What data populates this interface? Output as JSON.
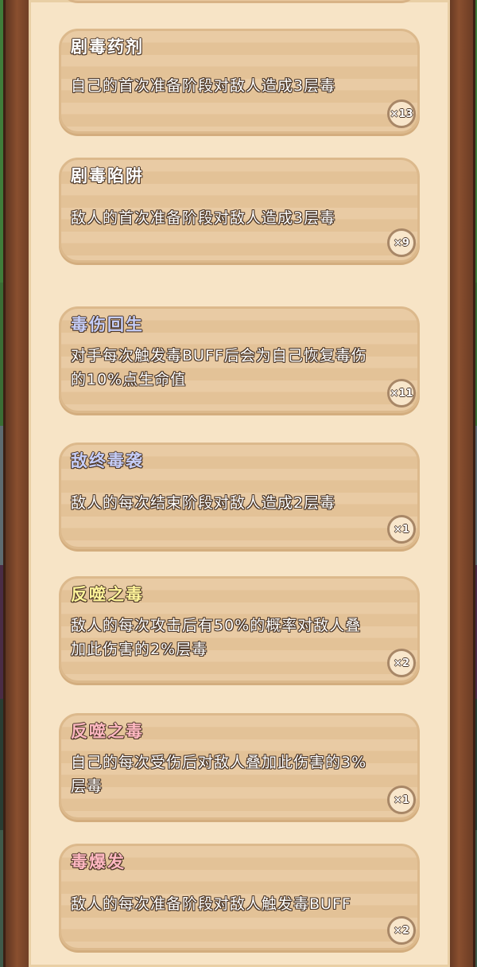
{
  "colors": {
    "title_default": "#ffffff",
    "title_blue": "#c5cdf8",
    "title_yellow": "#fff59a",
    "title_pink": "#ffb8c2",
    "outline": "#4a3526",
    "card": "#e8c89e",
    "panel": "#f7e4c6"
  },
  "cards": [
    {
      "title": "剧毒药剂",
      "description": "自己的首次准备阶段对敌人造成3层毒",
      "count": "×13",
      "title_color": "#ffffff"
    },
    {
      "title": "剧毒陷阱",
      "description": "敌人的首次准备阶段对敌人造成3层毒",
      "count": "×9",
      "title_color": "#ffffff"
    },
    {
      "title": "毒伤回生",
      "description": "对手每次触发毒BUFF后会为自己恢复毒伤的10%点生命值",
      "count": "×11",
      "title_color": "#c5cdf8"
    },
    {
      "title": "敌终毒袭",
      "description": "敌人的每次结束阶段对敌人造成2层毒",
      "count": "×1",
      "title_color": "#c5cdf8"
    },
    {
      "title": "反噬之毒",
      "description": "敌人的每次攻击后有50%的概率对敌人叠加此伤害的2%层毒",
      "count": "×2",
      "title_color": "#fff59a"
    },
    {
      "title": "反噬之毒",
      "description": "自己的每次受伤后对敌人叠加此伤害的3%层毒",
      "count": "×1",
      "title_color": "#ffb8c2"
    },
    {
      "title": "毒爆发",
      "description": "敌人的每次准备阶段对敌人触发毒BUFF",
      "count": "×2",
      "title_color": "#ffb8c2"
    }
  ]
}
